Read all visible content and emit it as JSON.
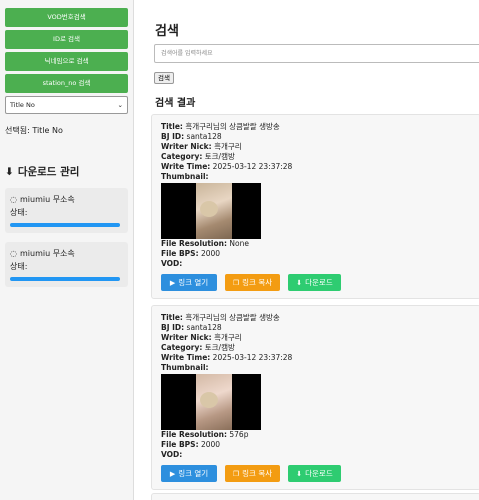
{
  "sidebar": {
    "buttons": [
      "VOD번호검색",
      "ID로 검색",
      "닉네임으로 검색",
      "station_no 검색"
    ],
    "select_value": "Title No",
    "selected_label": "선택됨: Title No",
    "download_title": "다운로드 관리",
    "downloads": [
      {
        "name": "miumiu 무소속",
        "status": "상태:",
        "progress": 1.0
      },
      {
        "name": "miumiu 무소속",
        "status": "상태:",
        "progress": 1.0
      }
    ]
  },
  "main": {
    "title": "검색",
    "search_placeholder": "검색어를 입력하세요",
    "search_button": "검색",
    "results_title": "검색 결과",
    "results": [
      {
        "title_label": "Title:",
        "title": "흑개구리님의 상큼발랄 생방송",
        "bj_label": "BJ ID:",
        "bj": "santa128",
        "nick_label": "Writer Nick:",
        "nick": "흑개구리",
        "category_label": "Category:",
        "category": "토크/캠방",
        "time_label": "Write Time:",
        "time": "2025-03-12 23:37:28",
        "thumb_label": "Thumbnail:",
        "resolution_label": "File Resolution:",
        "resolution": "None",
        "bps_label": "File BPS:",
        "bps": "2000",
        "vod_label": "VOD:"
      },
      {
        "title_label": "Title:",
        "title": "흑개구리님의 상큼발랄 생방송",
        "bj_label": "BJ ID:",
        "bj": "santa128",
        "nick_label": "Writer Nick:",
        "nick": "흑개구리",
        "category_label": "Category:",
        "category": "토크/캠방",
        "time_label": "Write Time:",
        "time": "2025-03-12 23:37:28",
        "thumb_label": "Thumbnail:",
        "resolution_label": "File Resolution:",
        "resolution": "576p",
        "bps_label": "File BPS:",
        "bps": "2000",
        "vod_label": "VOD:"
      }
    ],
    "actions": {
      "open": "링크 열기",
      "copy": "링크 복사",
      "download": "다운로드"
    }
  },
  "colors": {
    "sidebar_button": "#4caf50",
    "open": "#2d8fde",
    "copy": "#f39c12",
    "download": "#2ecc71",
    "progress": "#2196f3"
  }
}
